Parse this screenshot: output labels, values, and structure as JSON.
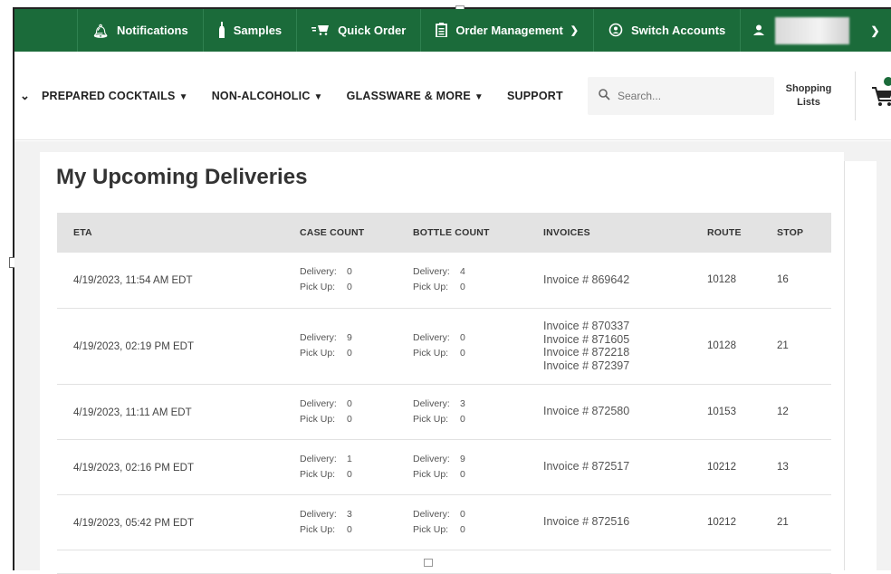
{
  "topbar": {
    "notifications_label": "Notifications",
    "samples_label": "Samples",
    "quick_order_label": "Quick Order",
    "order_management_label": "Order Management",
    "switch_accounts_label": "Switch Accounts",
    "brand_color": "#1b6b3a"
  },
  "nav": {
    "items": [
      {
        "label": "PREPARED COCKTAILS"
      },
      {
        "label": "NON-ALCOHOLIC"
      },
      {
        "label": "GLASSWARE & MORE"
      },
      {
        "label": "SUPPORT"
      }
    ],
    "search_placeholder": "Search...",
    "shopping_lists_label_1": "Shopping",
    "shopping_lists_label_2": "Lists"
  },
  "page": {
    "title": "My Upcoming Deliveries"
  },
  "table": {
    "headers": {
      "eta": "ETA",
      "case_count": "CASE COUNT",
      "bottle_count": "BOTTLE COUNT",
      "invoices": "INVOICES",
      "route": "ROUTE",
      "stop": "STOP"
    },
    "delivery_label": "Delivery:",
    "pickup_label": "Pick Up:",
    "rows": [
      {
        "eta": "4/19/2023, 11:54 AM EDT",
        "case_delivery": "0",
        "case_pickup": "0",
        "bottle_delivery": "4",
        "bottle_pickup": "0",
        "invoices": [
          "Invoice # 869642"
        ],
        "route": "10128",
        "stop": "16"
      },
      {
        "eta": "4/19/2023, 02:19 PM EDT",
        "case_delivery": "9",
        "case_pickup": "0",
        "bottle_delivery": "0",
        "bottle_pickup": "0",
        "invoices": [
          "Invoice # 870337",
          "Invoice # 871605",
          "Invoice # 872218",
          "Invoice # 872397"
        ],
        "route": "10128",
        "stop": "21"
      },
      {
        "eta": "4/19/2023, 11:11 AM EDT",
        "case_delivery": "0",
        "case_pickup": "0",
        "bottle_delivery": "3",
        "bottle_pickup": "0",
        "invoices": [
          "Invoice # 872580"
        ],
        "route": "10153",
        "stop": "12"
      },
      {
        "eta": "4/19/2023, 02:16 PM EDT",
        "case_delivery": "1",
        "case_pickup": "0",
        "bottle_delivery": "9",
        "bottle_pickup": "0",
        "invoices": [
          "Invoice # 872517"
        ],
        "route": "10212",
        "stop": "13"
      },
      {
        "eta": "4/19/2023, 05:42 PM EDT",
        "case_delivery": "3",
        "case_pickup": "0",
        "bottle_delivery": "0",
        "bottle_pickup": "0",
        "invoices": [
          "Invoice # 872516"
        ],
        "route": "10212",
        "stop": "21"
      }
    ]
  }
}
